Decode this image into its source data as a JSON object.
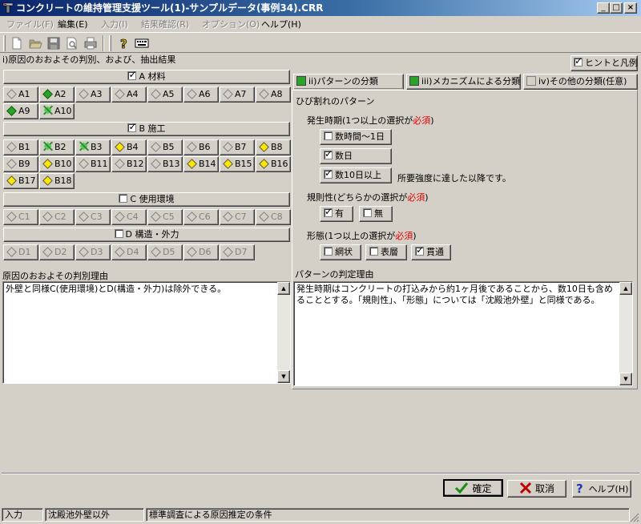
{
  "window": {
    "title": "コンクリートの維持管理支援ツール(1)-サンプルデータ(事例34).CRR",
    "controls": {
      "minimize": "_",
      "maximize": "□",
      "close": "×"
    }
  },
  "menu": [
    {
      "label": "ファイル(F)",
      "enabled": false
    },
    {
      "label": "編集(E)",
      "enabled": true
    },
    {
      "label": "入力(I)",
      "enabled": false
    },
    {
      "label": "結果確認(R)",
      "enabled": false
    },
    {
      "label": "オプション(O)",
      "enabled": false
    },
    {
      "label": "ヘルプ(H)",
      "enabled": true
    }
  ],
  "toolbar_icons": [
    "new-file-icon",
    "open-folder-icon",
    "save-icon",
    "print-preview-icon",
    "print-icon",
    "help-icon",
    "keyboard-icon"
  ],
  "left": {
    "section_title": "i)原因のおおよその判別、および、抽出結果",
    "groups": {
      "a": {
        "label": "A 材料",
        "checked": true
      },
      "b": {
        "label": "B 施工",
        "checked": true
      },
      "c": {
        "label": "C 使用環境",
        "checked": false
      },
      "d": {
        "label": "D 構造・外力",
        "checked": false
      }
    },
    "items": {
      "a": [
        {
          "label": "A1",
          "mark": "gray"
        },
        {
          "label": "A2",
          "mark": "green"
        },
        {
          "label": "A3",
          "mark": "gray"
        },
        {
          "label": "A4",
          "mark": "gray"
        },
        {
          "label": "A5",
          "mark": "gray"
        },
        {
          "label": "A6",
          "mark": "gray"
        },
        {
          "label": "A7",
          "mark": "gray"
        },
        {
          "label": "A8",
          "mark": "gray"
        },
        {
          "label": "A9",
          "mark": "green"
        },
        {
          "label": "A10",
          "mark": "cross"
        }
      ],
      "b": [
        {
          "label": "B1",
          "mark": "gray"
        },
        {
          "label": "B2",
          "mark": "cross"
        },
        {
          "label": "B3",
          "mark": "cross"
        },
        {
          "label": "B4",
          "mark": "yellow"
        },
        {
          "label": "B5",
          "mark": "gray"
        },
        {
          "label": "B6",
          "mark": "gray"
        },
        {
          "label": "B7",
          "mark": "gray"
        },
        {
          "label": "B8",
          "mark": "yellow"
        },
        {
          "label": "B9",
          "mark": "gray"
        },
        {
          "label": "B10",
          "mark": "yellow"
        },
        {
          "label": "B11",
          "mark": "gray"
        },
        {
          "label": "B12",
          "mark": "gray"
        },
        {
          "label": "B13",
          "mark": "gray"
        },
        {
          "label": "B14",
          "mark": "yellow"
        },
        {
          "label": "B15",
          "mark": "yellow"
        },
        {
          "label": "B16",
          "mark": "yellow"
        },
        {
          "label": "B17",
          "mark": "yellow"
        },
        {
          "label": "B18",
          "mark": "yellow"
        }
      ],
      "c": [
        {
          "label": "C1",
          "mark": "gray"
        },
        {
          "label": "C2",
          "mark": "gray"
        },
        {
          "label": "C3",
          "mark": "gray"
        },
        {
          "label": "C4",
          "mark": "gray"
        },
        {
          "label": "C5",
          "mark": "gray"
        },
        {
          "label": "C6",
          "mark": "gray"
        },
        {
          "label": "C7",
          "mark": "gray"
        },
        {
          "label": "C8",
          "mark": "gray"
        }
      ],
      "d": [
        {
          "label": "D1",
          "mark": "gray"
        },
        {
          "label": "D2",
          "mark": "gray"
        },
        {
          "label": "D3",
          "mark": "gray"
        },
        {
          "label": "D4",
          "mark": "gray"
        },
        {
          "label": "D5",
          "mark": "gray"
        },
        {
          "label": "D6",
          "mark": "gray"
        },
        {
          "label": "D7",
          "mark": "gray"
        }
      ]
    },
    "reason_title": "原因のおおよその判別理由",
    "reason_text": "外壁と同様C(使用環境)とD(構造・外力)は除外できる。"
  },
  "right": {
    "hint_checkbox": {
      "label": "ヒントと凡例",
      "checked": true
    },
    "tabs": [
      {
        "label": "ii)パターンの分類",
        "color": "#29a329"
      },
      {
        "label": "iii)メカニズムによる分類",
        "color": "#29a329"
      },
      {
        "label": "iv)その他の分類(任意)",
        "color": "#d4d0c8"
      }
    ],
    "pattern_title": "ひび割れのパターン",
    "occurrence": {
      "title": "発生時期(1つ以上の選択が",
      "req": "必須",
      "close": ")",
      "options": [
        {
          "label": "数時間〜1日",
          "checked": false
        },
        {
          "label": "数日",
          "checked": true
        },
        {
          "label": "数10日以上",
          "checked": true
        }
      ],
      "note": "所要強度に達した以降です。"
    },
    "regularity": {
      "title": "規則性(どちらかの選択が",
      "req": "必須",
      "close": ")",
      "options": [
        {
          "label": "有",
          "checked": true
        },
        {
          "label": "無",
          "checked": false
        }
      ]
    },
    "form": {
      "title": "形態(1つ以上の選択が",
      "req": "必須",
      "close": ")",
      "options": [
        {
          "label": "網状",
          "checked": false
        },
        {
          "label": "表層",
          "checked": false
        },
        {
          "label": "貫通",
          "checked": true
        }
      ]
    },
    "reason_title": "パターンの判定理由",
    "reason_text": "発生時期はコンクリートの打込みから約1ヶ月後であることから、数10日も含めることとする。「規則性」、「形態」については「沈殿池外壁」と同様である。"
  },
  "buttons": {
    "ok": "確定",
    "cancel": "取消",
    "help": "ヘルプ(H)"
  },
  "status": [
    "入力",
    "沈殿池外壁以外",
    "標準調査による原因推定の条件"
  ],
  "colors": {
    "title_start": "#0a246a",
    "title_end": "#a6caf0",
    "required": "#e00000",
    "face": "#d4d0c8"
  }
}
